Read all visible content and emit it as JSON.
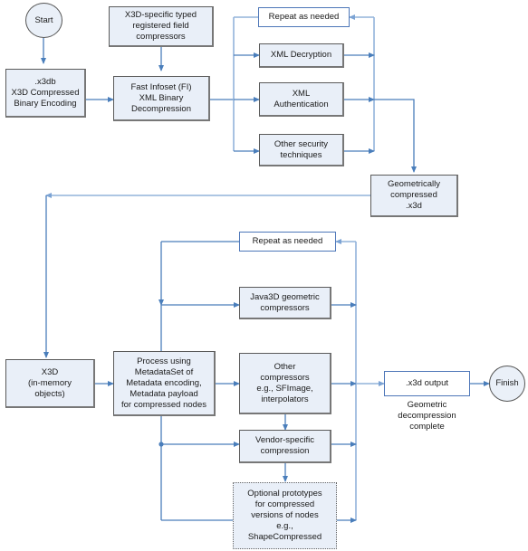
{
  "diagram": {
    "title": "X3D Compressed Binary Encoding decompression flowchart",
    "colors": {
      "node_fill": "#e9eff8",
      "node_border": "#5a5a5a",
      "wire": "#4a7ebb",
      "wire_light": "#92b3da",
      "plain_border": "#4d76b8"
    },
    "nodes": {
      "start": "Start",
      "x3db": ".x3db\nX3D Compressed\nBinary Encoding",
      "typed_compressors": "X3D-specific typed\nregistered field\ncompressors",
      "fast_infoset": "Fast Infoset (FI)\nXML Binary\nDecompression",
      "repeat_top": "Repeat as needed",
      "xml_decryption": "XML Decryption",
      "xml_authentication": "XML\nAuthentication",
      "other_security": "Other security\ntechniques",
      "geom_compressed": "Geometrically\ncompressed\n.x3d",
      "x3d_memory": "X3D\n(in-memory\nobjects)",
      "process_metadata": "Process using\nMetadataSet of\nMetadata encoding,\nMetadata payload\nfor compressed nodes",
      "repeat_bottom": "Repeat as needed",
      "java3d": "Java3D geometric\ncompressors",
      "other_compressors": "Other\ncompressors\ne.g., SFImage,\ninterpolators",
      "vendor_specific": "Vendor-specific\ncompression",
      "optional_prototypes": "Optional prototypes\nfor compressed\nversions of nodes\ne.g.,\nShapeCompressed",
      "x3d_output": ".x3d output",
      "finish": "Finish"
    },
    "captions": {
      "geometric_complete": "Geometric\ndecompression\ncomplete"
    }
  }
}
